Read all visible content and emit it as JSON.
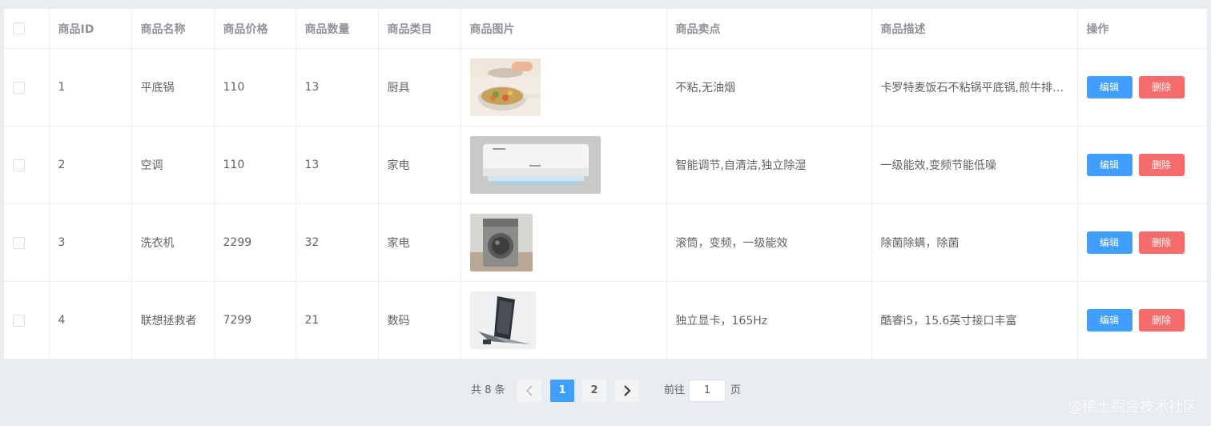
{
  "table": {
    "headers": [
      "",
      "商品ID",
      "商品名称",
      "商品价格",
      "商品数量",
      "商品类目",
      "商品图片",
      "商品卖点",
      "商品描述",
      "操作"
    ],
    "edit_label": "编辑",
    "delete_label": "删除",
    "rows": [
      {
        "id": "1",
        "name": "平底锅",
        "price": "110",
        "qty": "13",
        "category": "厨具",
        "selling": "不粘,无油烟",
        "desc": "卡罗特麦饭石不粘锅平底锅,煎牛排…",
        "image": "pan-image"
      },
      {
        "id": "2",
        "name": "空调",
        "price": "110",
        "qty": "13",
        "category": "家电",
        "selling": "智能调节,自清洁,独立除湿",
        "desc": "一级能效,变频节能低噪",
        "image": "air-conditioner-image"
      },
      {
        "id": "3",
        "name": "洗衣机",
        "price": "2299",
        "qty": "32",
        "category": "家电",
        "selling": "滚筒，变频，一级能效",
        "desc": "除菌除螨，除菌",
        "image": "washing-machine-image"
      },
      {
        "id": "4",
        "name": "联想拯救者",
        "price": "7299",
        "qty": "21",
        "category": "数码",
        "selling": "独立显卡，165Hz",
        "desc": "酷睿i5，15.6英寸接口丰富",
        "image": "laptop-image"
      }
    ]
  },
  "pagination": {
    "total": "共 8 条",
    "pages": [
      "1",
      "2"
    ],
    "current_page": "1",
    "goto_label": "前往",
    "goto_value": "1",
    "page_suffix": "页",
    "prev_icon": "chevron-left-icon",
    "next_icon": "chevron-right-icon"
  },
  "watermark": "@稀土掘金技术社区",
  "colors": {
    "background": "#e9edf2",
    "primary": "#409eff",
    "danger": "#f56c6c",
    "header_text": "#909399"
  }
}
